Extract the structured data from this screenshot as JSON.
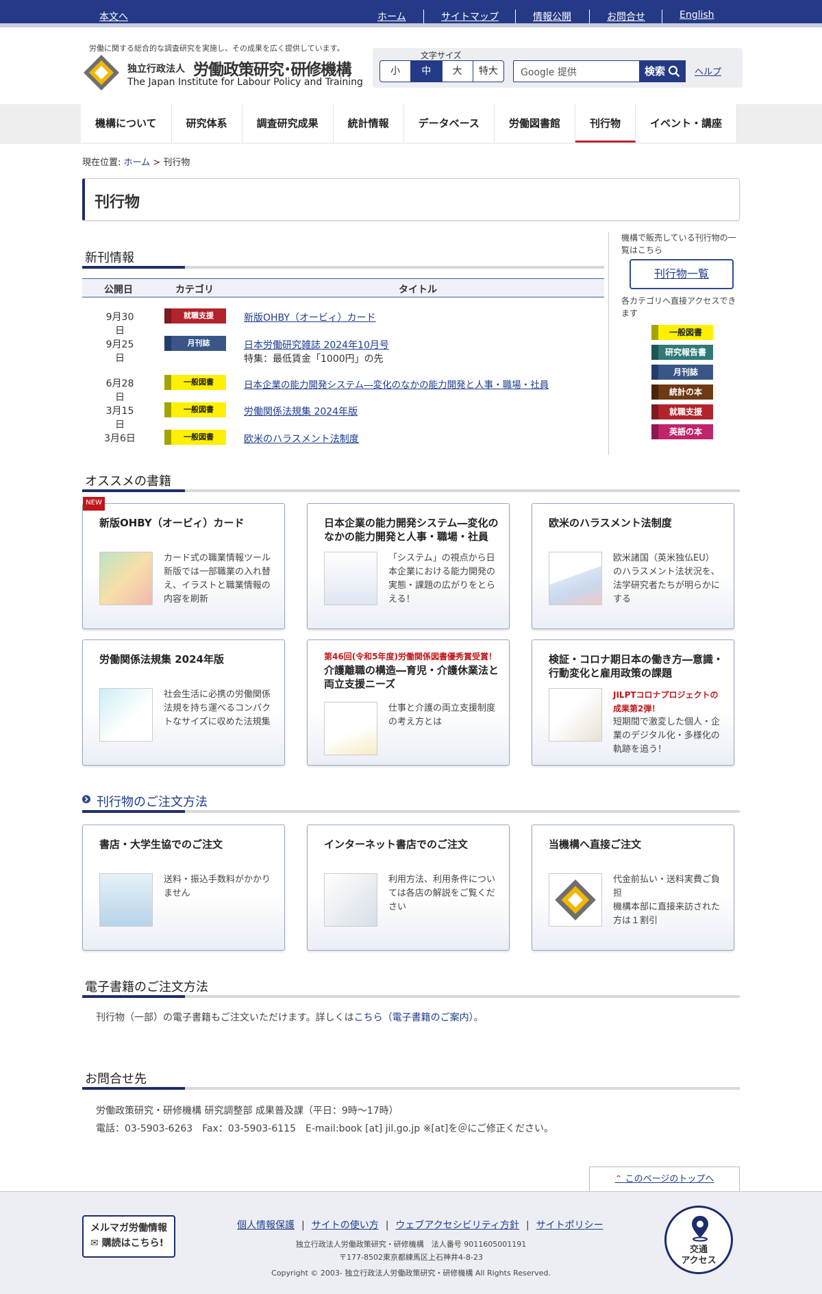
{
  "topbar": {
    "skip": "本文へ",
    "links": [
      "ホーム",
      "サイトマップ",
      "情報公開",
      "お問合せ",
      "English"
    ]
  },
  "header": {
    "tagline": "労働に関する総合的な調査研究を実施し、その成果を広く提供しています。",
    "org_small": "独立行政法人",
    "org_big": "労働政策研究･研修機構",
    "org_en": "The Japan Institute for Labour Policy and Training",
    "fontsize_label": "文字サイズ",
    "fontsize_options": [
      "小",
      "中",
      "大",
      "特大"
    ],
    "fontsize_selected": "中",
    "search_placeholder": "Google 提供",
    "search_button": "検索",
    "help": "ヘルプ"
  },
  "gnav": [
    "機構について",
    "研究体系",
    "調査研究成果",
    "統計情報",
    "データベース",
    "労働図書館",
    "刊行物",
    "イベント・講座"
  ],
  "breadcrumb": {
    "prefix": "現在位置:",
    "home": "ホーム",
    "current": "> 刊行物"
  },
  "page_title": "刊行物",
  "new_info": {
    "heading": "新刊情報",
    "cols": [
      "公開日",
      "カテゴリ",
      "タイトル"
    ],
    "rows": [
      {
        "date": "9月30日",
        "cat": "就職支援",
        "title": "新版OHBY（オービィ）カード",
        "sub": ""
      },
      {
        "date": "9月25日",
        "cat": "月刊誌",
        "title": "日本労働研究雑誌 2024年10月号",
        "sub": "特集：最低賃金「1000円」の先"
      },
      {
        "date": "6月28日",
        "cat": "一般図書",
        "title": "日本企業の能力開発システム―変化のなかの能力開発と人事・職場・社員",
        "sub": ""
      },
      {
        "date": "3月15日",
        "cat": "一般図書",
        "title": "労働関係法規集 2024年版",
        "sub": ""
      },
      {
        "date": "3月6日",
        "cat": "一般図書",
        "title": "欧米のハラスメント法制度",
        "sub": ""
      }
    ]
  },
  "sidebar": {
    "text1": "機構で販売している刊行物の一覧はこちら",
    "button": "刊行物一覧",
    "text2": "各カテゴリへ直接アクセスできます",
    "cats": [
      "一般図書",
      "研究報告書",
      "月刊誌",
      "統計の本",
      "就職支援",
      "英語の本"
    ]
  },
  "recommend": {
    "heading": "オススメの書籍",
    "new_badge": "NEW",
    "cards": [
      {
        "title": "新版OHBY（オービィ）カード",
        "award": "",
        "desc": "カード式の職業情報ツール\n新版では一部職業の入れ替え、イラストと職業情報の内容を刷新",
        "jilpt": ""
      },
      {
        "title": "日本企業の能力開発システム―変化のなかの能力開発と人事・職場・社員",
        "award": "",
        "desc": "「システム」の視点から日本企業における能力開発の実態・課題の広がりをとらえる！",
        "jilpt": ""
      },
      {
        "title": "欧米のハラスメント法制度",
        "award": "",
        "desc": "欧米諸国（英米独仏EU）のハラスメント法状況を、法学研究者たちが明らかにする",
        "jilpt": ""
      },
      {
        "title": "労働関係法規集 2024年版",
        "award": "",
        "desc": "社会生活に必携の労働関係法規を持ち運べるコンパクトなサイズに収めた法規集",
        "jilpt": ""
      },
      {
        "title": "介護離職の構造―育児・介護休業法と両立支援ニーズ",
        "award": "第46回(令和5年度)労働関係図書優秀賞受賞！",
        "desc": "仕事と介護の両立支援制度の考え方とは",
        "jilpt": ""
      },
      {
        "title": "検証・コロナ期日本の働き方―意識・行動変化と雇用政策の課題",
        "award": "",
        "desc": "短期間で激変した個人・企業のデジタル化・多様化の軌跡を追う！",
        "jilpt": "JILPTコロナプロジェクトの成果第2弾！"
      }
    ]
  },
  "order": {
    "heading": "刊行物のご注文方法",
    "cards": [
      {
        "title": "書店・大学生協でのご注文",
        "desc": "送料・振込手数料がかかりません"
      },
      {
        "title": "インターネット書店でのご注文",
        "desc": "利用方法、利用条件については各店の解説をご覧ください"
      },
      {
        "title": "当機構へ直接ご注文",
        "desc": "代金前払い・送料実費ご負担\n機構本部に直接来訪された方は１割引"
      }
    ]
  },
  "ebook": {
    "heading": "電子書籍のご注文方法",
    "text": "刊行物（一部）の電子書籍もご注文いただけます。詳しくは",
    "link": "こちら（電子書籍のご案内）",
    "end": "。"
  },
  "contact": {
    "heading": "お問合せ先",
    "line1": "労働政策研究・研修機構 研究調整部 成果普及課（平日：9時～17時）",
    "line2": "電話：03-5903-6263　Fax：03-5903-6115　E-mail:book [at] jil.go.jp ※[at]を＠にご修正ください。"
  },
  "pagetop": "このページのトップへ",
  "footer": {
    "links": [
      "個人情報保護",
      "サイトの使い方",
      "ウェブアクセシビリティ方針",
      "サイトポリシー"
    ],
    "line1": "独立行政法人労働政策研究・研修機構　法人番号 9011605001191",
    "line2": "〒177-8502東京都練馬区上石神井4-8-23",
    "copyright": "Copyright © 2003- 独立行政法人労働政策研究・研修機構 All Rights Reserved.",
    "mailmag1": "メルマガ労働情報",
    "mailmag2": "購読はこちら!",
    "access1": "交通",
    "access2": "アクセス"
  },
  "colors": {
    "brand": "#243a86",
    "accent_red": "#b8282c",
    "yellow": "#fff000"
  }
}
